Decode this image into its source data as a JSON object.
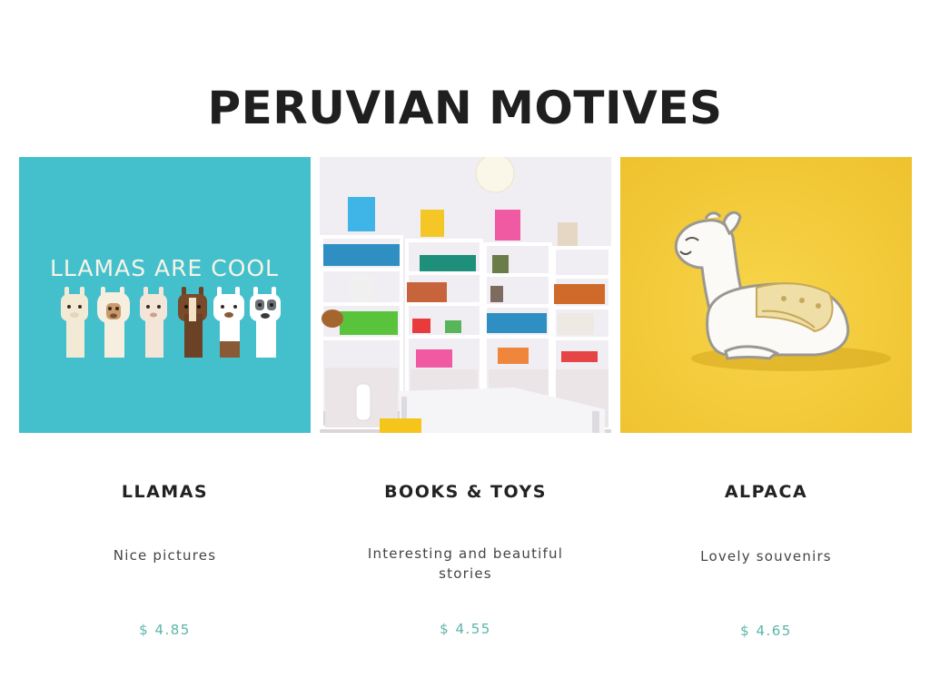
{
  "page": {
    "title": "PERUVIAN MOTIVES"
  },
  "colors": {
    "price": "#5bb5a8",
    "llamas_bg": "#44c0cd",
    "alpaca_bg": "#f5cf3a",
    "room_bg": "#f1eef3"
  },
  "products": [
    {
      "name": "LLAMAS",
      "description": "Nice pictures",
      "price": "$ 4.85",
      "image": {
        "icon": "llamas-poster-image",
        "caption": "LLAMAS ARE COOL"
      }
    },
    {
      "name": "BOOKS & TOYS",
      "description": "Interesting and beautiful stories",
      "price": "$ 4.55",
      "image": {
        "icon": "kids-room-bookshelf-image"
      }
    },
    {
      "name": "ALPACA",
      "description": "Lovely souvenirs",
      "price": "$ 4.65",
      "image": {
        "icon": "alpaca-pin-image"
      }
    }
  ]
}
